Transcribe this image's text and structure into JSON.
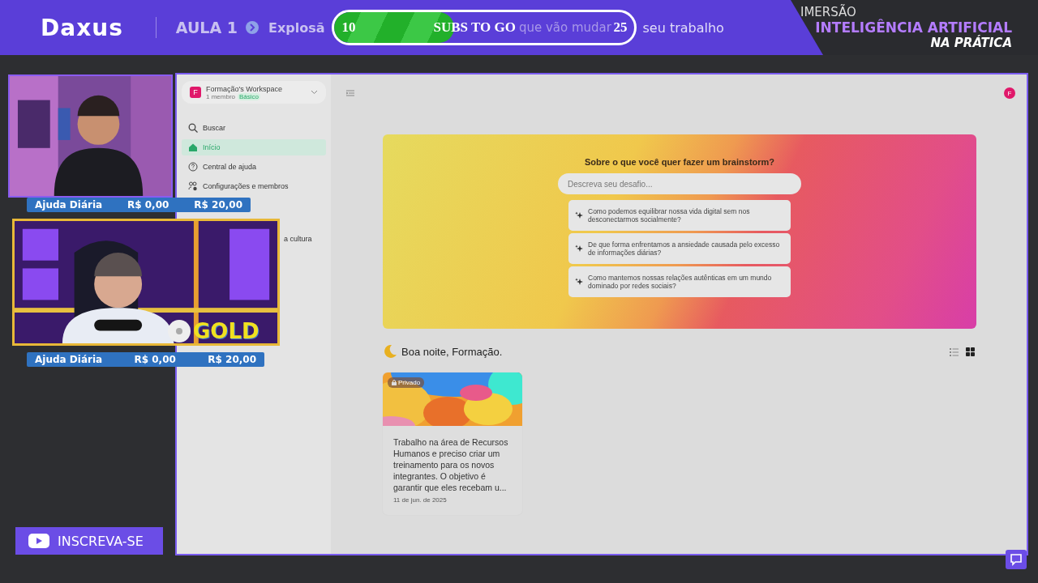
{
  "header": {
    "logo": "Daxus",
    "lesson": "AULA 1",
    "title_before": "Explosã",
    "title_behind": "que vão mudar",
    "title_after": "seu trabalho",
    "series": [
      "IMERSÃO",
      "INTELIGÊNCIA ARTIFICIAL",
      "NA PRÁTICA"
    ]
  },
  "subs_goal": {
    "current": "10",
    "label": "SUBS TO GO",
    "target": "25",
    "level": 0.4
  },
  "app": {
    "workspace": {
      "avatar": "F",
      "name": "Formação's Workspace",
      "members": "1 membro",
      "plan": "Básico"
    },
    "nav": [
      {
        "label": "Buscar",
        "kind": "search",
        "selected": false
      },
      {
        "label": "Início",
        "kind": "home",
        "selected": true
      },
      {
        "label": "Central de ajuda",
        "kind": "help",
        "selected": false
      },
      {
        "label": "Configurações e membros",
        "kind": "settings",
        "selected": false
      }
    ],
    "recent": [
      "a cultura"
    ],
    "user_avatar": "F",
    "brainstorm": {
      "title": "Sobre o que você quer fazer um brainstorm?",
      "placeholder": "Descreva seu desafio...",
      "suggestions": [
        "Como podemos equilibrar nossa vida digital sem nos desconectarmos socialmente?",
        "De que forma enfrentamos a ansiedade causada pelo excesso de informações diárias?",
        "Como mantemos nossas relações autênticas em um mundo dominado por redes sociais?"
      ]
    },
    "greeting": "Boa noite, Formação.",
    "view_modes": [
      {
        "kind": "list",
        "selected": false
      },
      {
        "kind": "grid",
        "selected": true
      }
    ],
    "cards": [
      {
        "badge": "Privado",
        "text": "Trabalho na área de Recursos Humanos e preciso criar um treinamento para os novos integrantes. O objetivo é garantir que eles recebam u...",
        "date": "11 de jun. de 2025"
      }
    ]
  },
  "overlay": {
    "donation_bars": [
      {
        "label": "Ajuda Diária",
        "raised": "R$ 0,00",
        "goal": "R$ 20,00"
      },
      {
        "label": "Ajuda Diária",
        "raised": "R$ 0,00",
        "goal": "R$ 20,00"
      }
    ],
    "gold_badge": "GOLD",
    "subscribe_button": "INSCREVA-SE"
  }
}
